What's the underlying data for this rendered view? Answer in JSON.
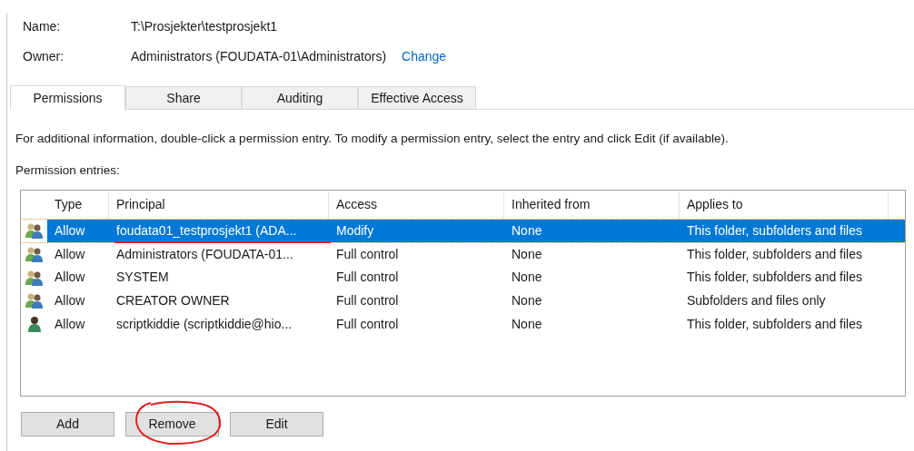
{
  "name": {
    "label": "Name:",
    "value": "T:\\Prosjekter\\testprosjekt1"
  },
  "owner": {
    "label": "Owner:",
    "value": "Administrators (FOUDATA-01\\Administrators)",
    "link": "Change"
  },
  "tabs": [
    {
      "label": "Permissions",
      "selected": true
    },
    {
      "label": "Share",
      "selected": false
    },
    {
      "label": "Auditing",
      "selected": false
    },
    {
      "label": "Effective Access",
      "selected": false
    }
  ],
  "info": "For additional information, double-click a permission entry. To modify a permission entry, select the entry and click Edit (if available).",
  "entries_label": "Permission entries:",
  "table": {
    "columns": [
      "Type",
      "Principal",
      "Access",
      "Inherited from",
      "Applies to"
    ],
    "rows": [
      {
        "kind": "group",
        "selected": true,
        "underlined": true,
        "cells": [
          "Allow",
          "foudata01_testprosjekt1 (ADA...",
          "Modify",
          "None",
          "This folder, subfolders and files"
        ]
      },
      {
        "kind": "group",
        "selected": false,
        "underlined": false,
        "cells": [
          "Allow",
          "Administrators (FOUDATA-01...",
          "Full control",
          "None",
          "This folder, subfolders and files"
        ]
      },
      {
        "kind": "group",
        "selected": false,
        "underlined": false,
        "cells": [
          "Allow",
          "SYSTEM",
          "Full control",
          "None",
          "This folder, subfolders and files"
        ]
      },
      {
        "kind": "group",
        "selected": false,
        "underlined": false,
        "cells": [
          "Allow",
          "CREATOR OWNER",
          "Full control",
          "None",
          "Subfolders and files only"
        ]
      },
      {
        "kind": "user",
        "selected": false,
        "underlined": false,
        "cells": [
          "Allow",
          "scriptkiddie (scriptkiddie@hio...",
          "Full control",
          "None",
          "This folder, subfolders and files"
        ]
      }
    ]
  },
  "buttons": [
    {
      "label": "Add",
      "circled": false
    },
    {
      "label": "Remove",
      "circled": true
    },
    {
      "label": "Edit",
      "circled": false
    }
  ]
}
